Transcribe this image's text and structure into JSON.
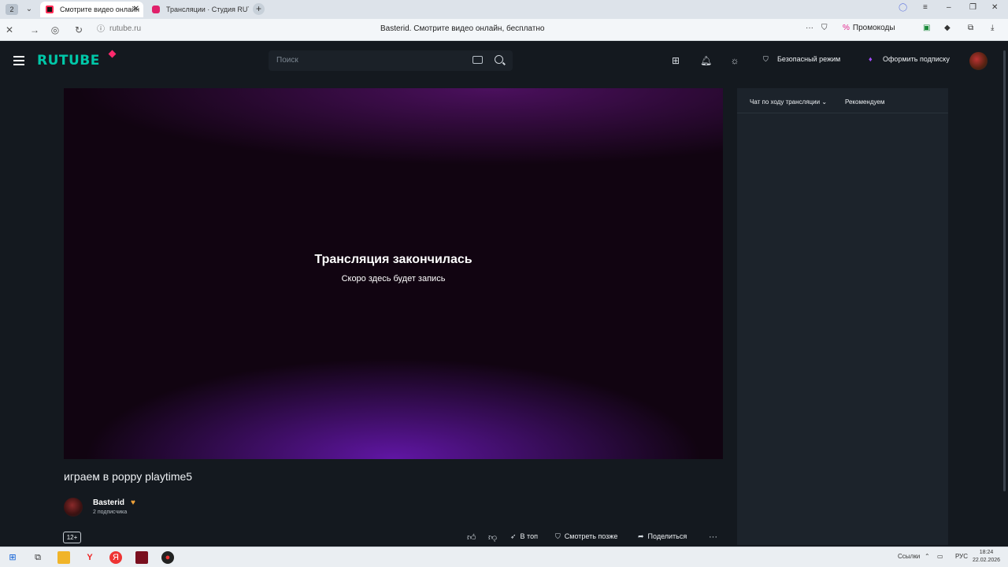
{
  "browser": {
    "tab_count": "2",
    "tabs": [
      {
        "label": "Смотрите видео онлайн"
      },
      {
        "label": "Трансляции · Студия RUT"
      }
    ],
    "url": "rutube.ru",
    "page_title": "Basterid. Смотрите видео онлайн, бесплатно",
    "promo_label": "Промокоды"
  },
  "header": {
    "logo": "RUTUBE",
    "search_placeholder": "Поиск",
    "safe_mode_label": "Безопасный режим",
    "subscribe_label": "Оформить подписку"
  },
  "player": {
    "status_title": "Трансляция закончилась",
    "status_subtitle": "Скоро здесь будет запись"
  },
  "video": {
    "title": "играем в poppy playtime5",
    "channel_name": "Basterid",
    "subscribers": "2 подписчика",
    "age_rating": "12+",
    "actions": {
      "top": "В топ",
      "watch_later": "Смотреть позже",
      "share": "Поделиться"
    }
  },
  "side_panel": {
    "chat_tab": "Чат по ходу трансляции",
    "recommended_tab": "Рекомендуем"
  },
  "taskbar": {
    "links_label": "Ссылки",
    "lang": "РУС",
    "time": "18:24",
    "date": "22.02.2026"
  },
  "colors": {
    "accent": "#00c7a8",
    "brand_pink": "#ff2a6d",
    "subscribe_icon": "#a34bff",
    "background": "#14191f"
  }
}
